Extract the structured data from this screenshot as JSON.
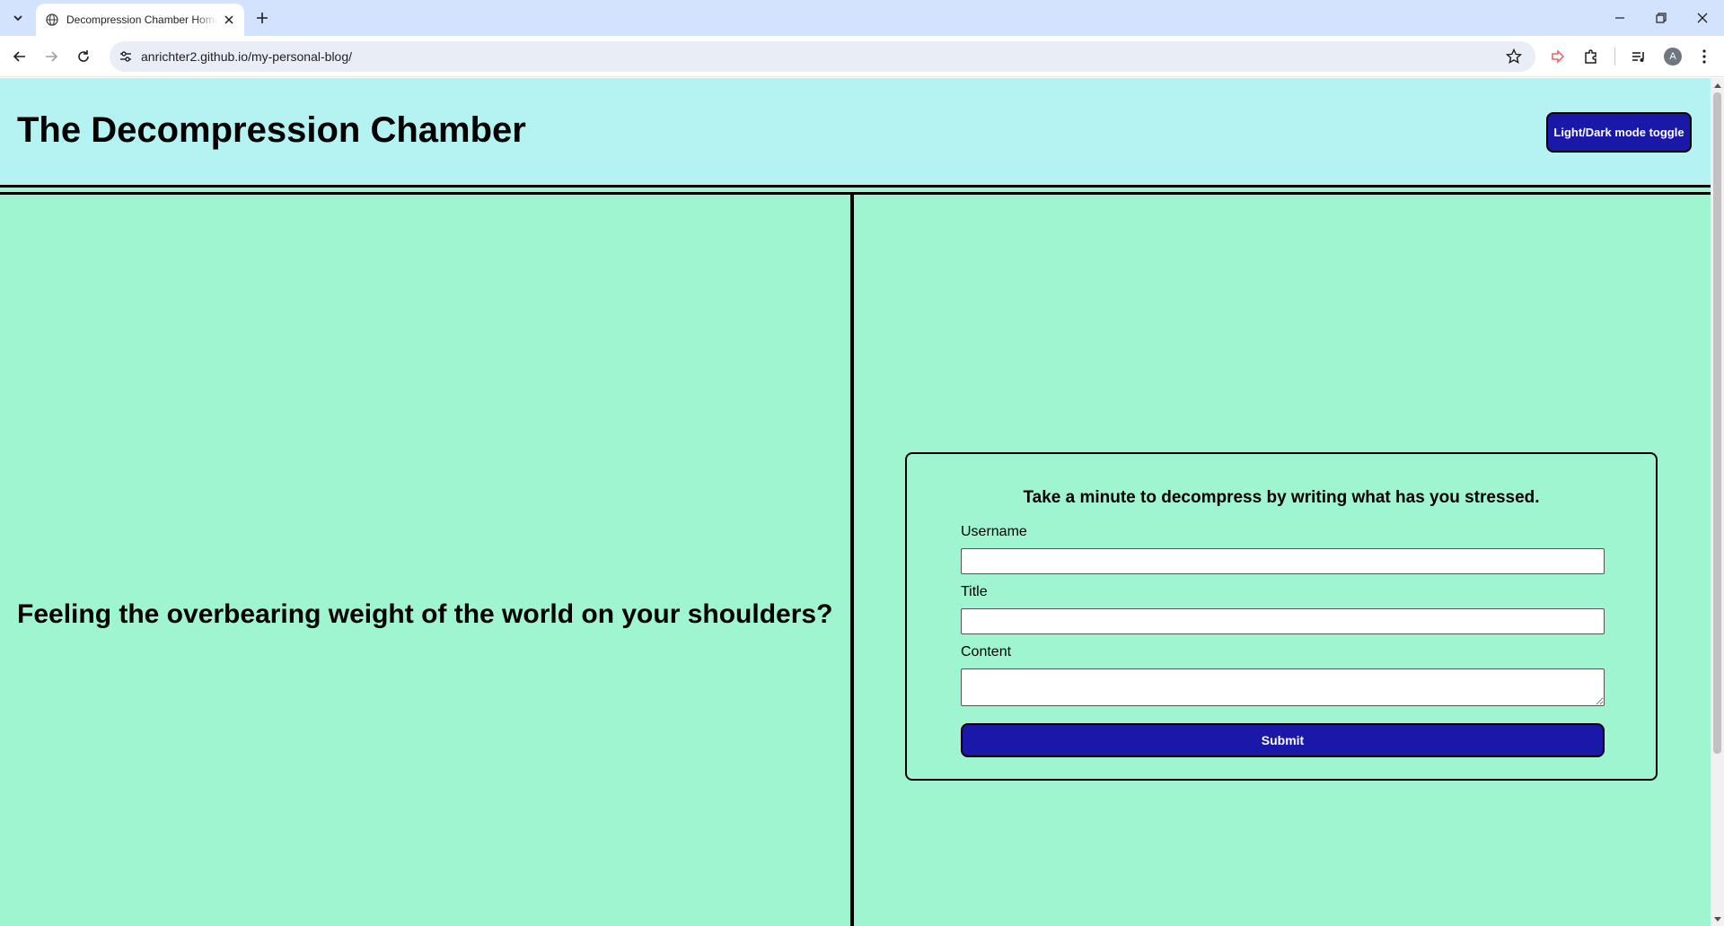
{
  "browser": {
    "tab_title": "Decompression Chamber Home",
    "url": "anrichter2.github.io/my-personal-blog/",
    "avatar_initial": "A"
  },
  "header": {
    "title": "The Decompression Chamber",
    "toggle_label": "Light/Dark mode toggle"
  },
  "main": {
    "tagline": "Feeling the overbearing weight of the world on your shoulders?"
  },
  "form": {
    "heading": "Take a minute to decompress by writing what has you stressed.",
    "username_label": "Username",
    "username_value": "",
    "title_label": "Title",
    "title_value": "",
    "content_label": "Content",
    "content_value": "",
    "submit_label": "Submit"
  },
  "colors": {
    "header_bg": "#b5f3f3",
    "page_bg": "#a0f5d1",
    "button_bg": "#1a18a8",
    "tabbar_bg": "#d3e3fd"
  }
}
